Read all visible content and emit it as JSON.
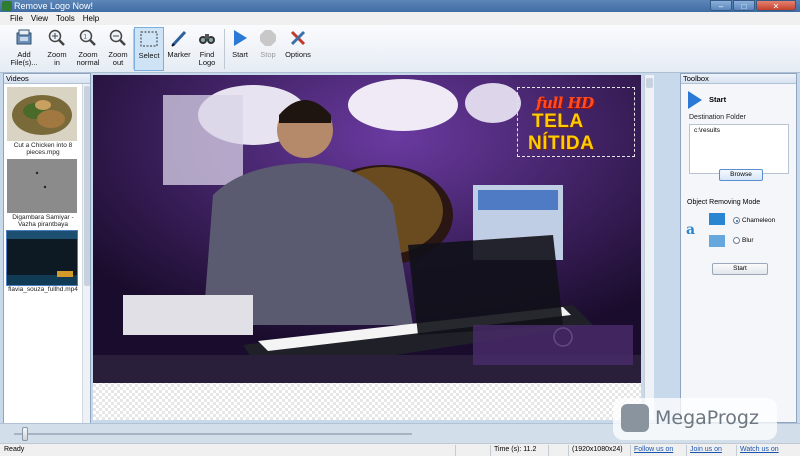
{
  "window": {
    "title": "Remove Logo Now!",
    "controls": [
      "–",
      "□",
      "✕"
    ]
  },
  "menu": [
    "File",
    "View",
    "Tools",
    "Help"
  ],
  "toolbar": {
    "add_files": "Add File(s)...",
    "zoom_in": "Zoom in",
    "zoom_normal": "Zoom normal",
    "zoom_out": "Zoom out",
    "select": "Select",
    "marker": "Marker",
    "find_logo": "Find Logo",
    "start": "Start",
    "stop": "Stop",
    "options": "Options"
  },
  "videos_panel": {
    "title": "Videos",
    "items": [
      {
        "label": "Cut a Chicken into 8 pieces.mpg"
      },
      {
        "label": "Digambara Samiyar - Vazha pirantbaya"
      },
      {
        "label": "flavia_souza_fullhd.mp4"
      }
    ]
  },
  "logo": {
    "line1": "full HD",
    "line2": "TELA",
    "line3": "NÍTIDA"
  },
  "toolbox": {
    "title": "Toolbox",
    "start_label": "Start",
    "destination_label": "Destination Folder",
    "destination_value": "c:\\results",
    "browse_label": "Browse",
    "mode_title": "Object Removing Mode",
    "mode_chameleon": "Chameleon",
    "mode_blur": "Blur",
    "selected_mode": "Chameleon",
    "start_button": "Start"
  },
  "status": {
    "ready": "Ready",
    "time": "Time (s): 11.2",
    "resolution": "(1920x1080x24)",
    "follow": "Follow us on",
    "join": "Join us on",
    "watch": "Watch us on"
  },
  "slider": {
    "position": 0.02
  },
  "watermark": {
    "text": "MegaProgz"
  }
}
